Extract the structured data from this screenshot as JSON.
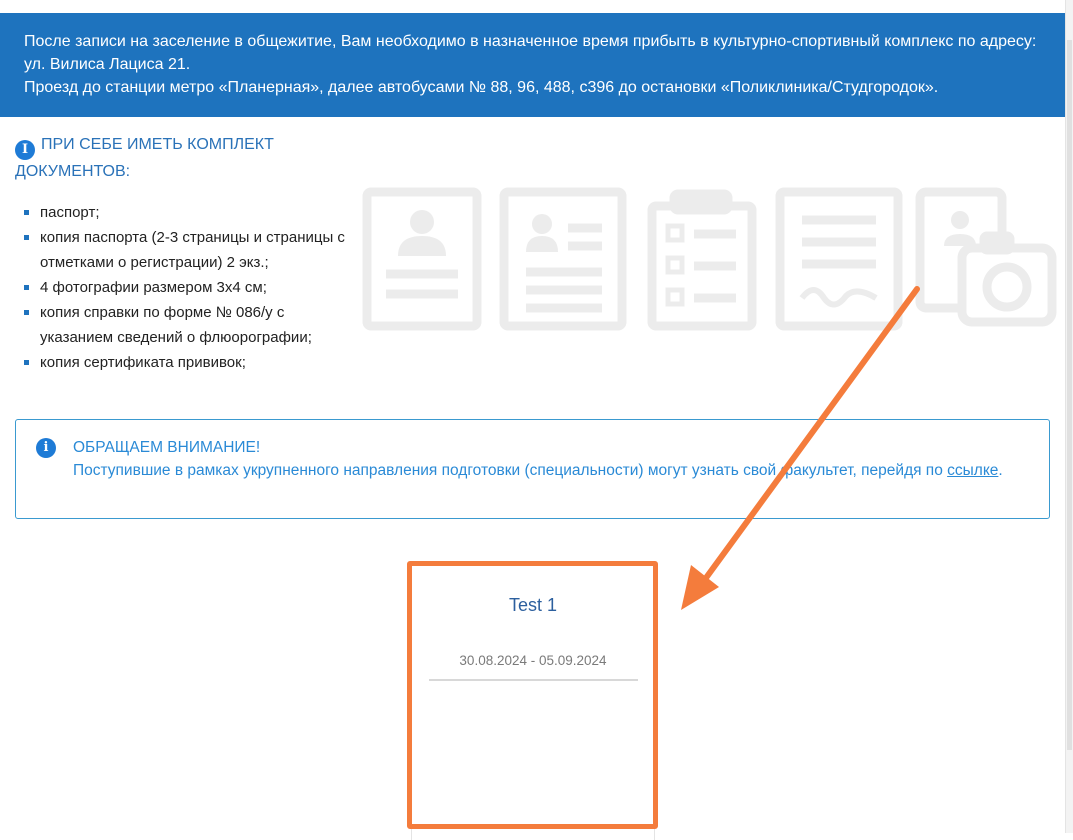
{
  "banner": {
    "line1": "После записи на заселение в общежитие, Вам необходимо в назначенное время прибыть в культурно-спортивный комплекс по адресу:",
    "line2": "ул. Вилиса Лациса 21.",
    "line3": "Проезд до станции метро «Планерная», далее автобусами № 88, 96, 488, с396 до остановки «Поликлиника/Студгородок»."
  },
  "documents": {
    "icon": "info-icon",
    "heading": "При себе иметь комплект документов:",
    "items": [
      "паспорт;",
      "копия паспорта (2-3 страницы и страницы с отметками о регистрации) 2 экз.;",
      "4 фотографии размером 3х4 см;",
      "копия справки по форме № 086/у с указанием сведений о флюорографии;",
      "копия сертификата прививок;"
    ],
    "illustrations": [
      "passport-icon",
      "id-card-icon",
      "checklist-icon",
      "signed-document-icon",
      "photo-camera-icon"
    ]
  },
  "notice": {
    "icon": "info-icon",
    "title": "Обращаем внимание!",
    "text": "Поступившие в рамках укрупненного направления подготовки (специальности) могут узнать свой факультет, перейдя по ",
    "link": "ссылке",
    "tail": "."
  },
  "card": {
    "title": "Test 1",
    "dates": "30.08.2024 - 05.09.2024"
  },
  "colors": {
    "banner": "#1e73be",
    "accent": "#2a8ad6",
    "annotation": "#f47c3c",
    "illustration": "#ececec"
  }
}
